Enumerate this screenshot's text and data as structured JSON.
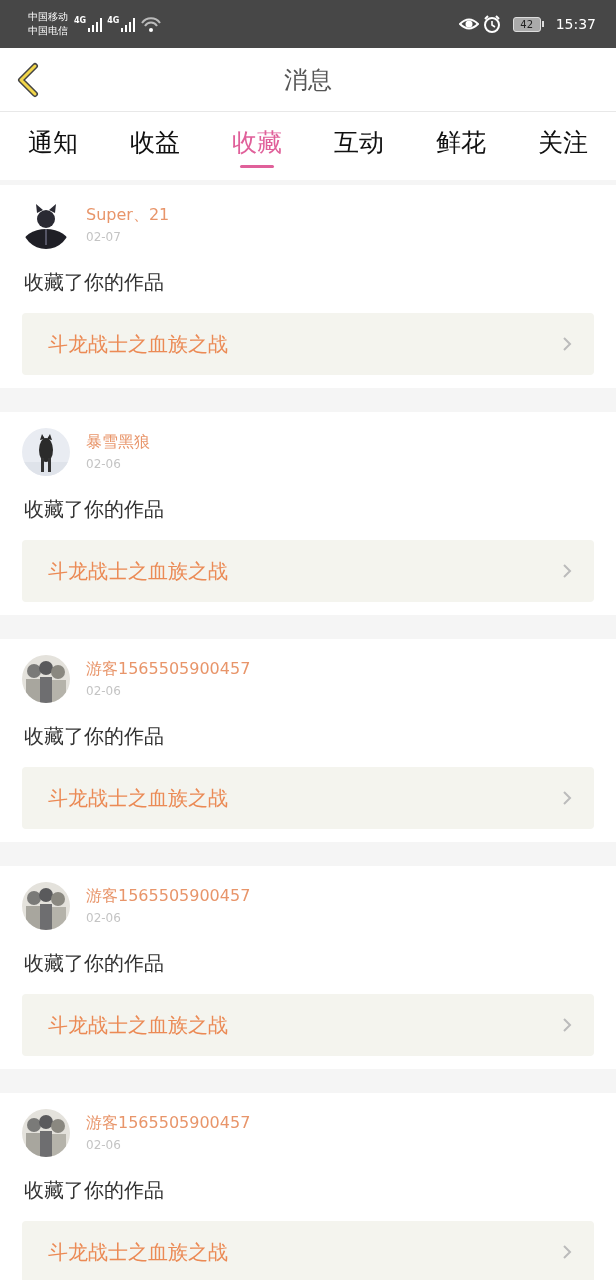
{
  "status_bar": {
    "carriers": [
      "中国移动",
      "中国电信"
    ],
    "networks": [
      "4G",
      "4G"
    ],
    "battery": "42",
    "time": "15:37"
  },
  "header": {
    "title": "消息"
  },
  "tabs": [
    {
      "label": "通知",
      "selected": false
    },
    {
      "label": "收益",
      "selected": false
    },
    {
      "label": "收藏",
      "selected": true
    },
    {
      "label": "互动",
      "selected": false
    },
    {
      "label": "鲜花",
      "selected": false
    },
    {
      "label": "关注",
      "selected": false
    }
  ],
  "messages": [
    {
      "user": "Super、21",
      "date": "02-07",
      "text": "收藏了你的作品",
      "work": "斗龙战士之血族之战"
    },
    {
      "user": "暴雪黑狼",
      "date": "02-06",
      "text": "收藏了你的作品",
      "work": "斗龙战士之血族之战"
    },
    {
      "user": "游客1565505900457",
      "date": "02-06",
      "text": "收藏了你的作品",
      "work": "斗龙战士之血族之战"
    },
    {
      "user": "游客1565505900457",
      "date": "02-06",
      "text": "收藏了你的作品",
      "work": "斗龙战士之血族之战"
    },
    {
      "user": "游客1565505900457",
      "date": "02-06",
      "text": "收藏了你的作品",
      "work": "斗龙战士之血族之战"
    }
  ]
}
